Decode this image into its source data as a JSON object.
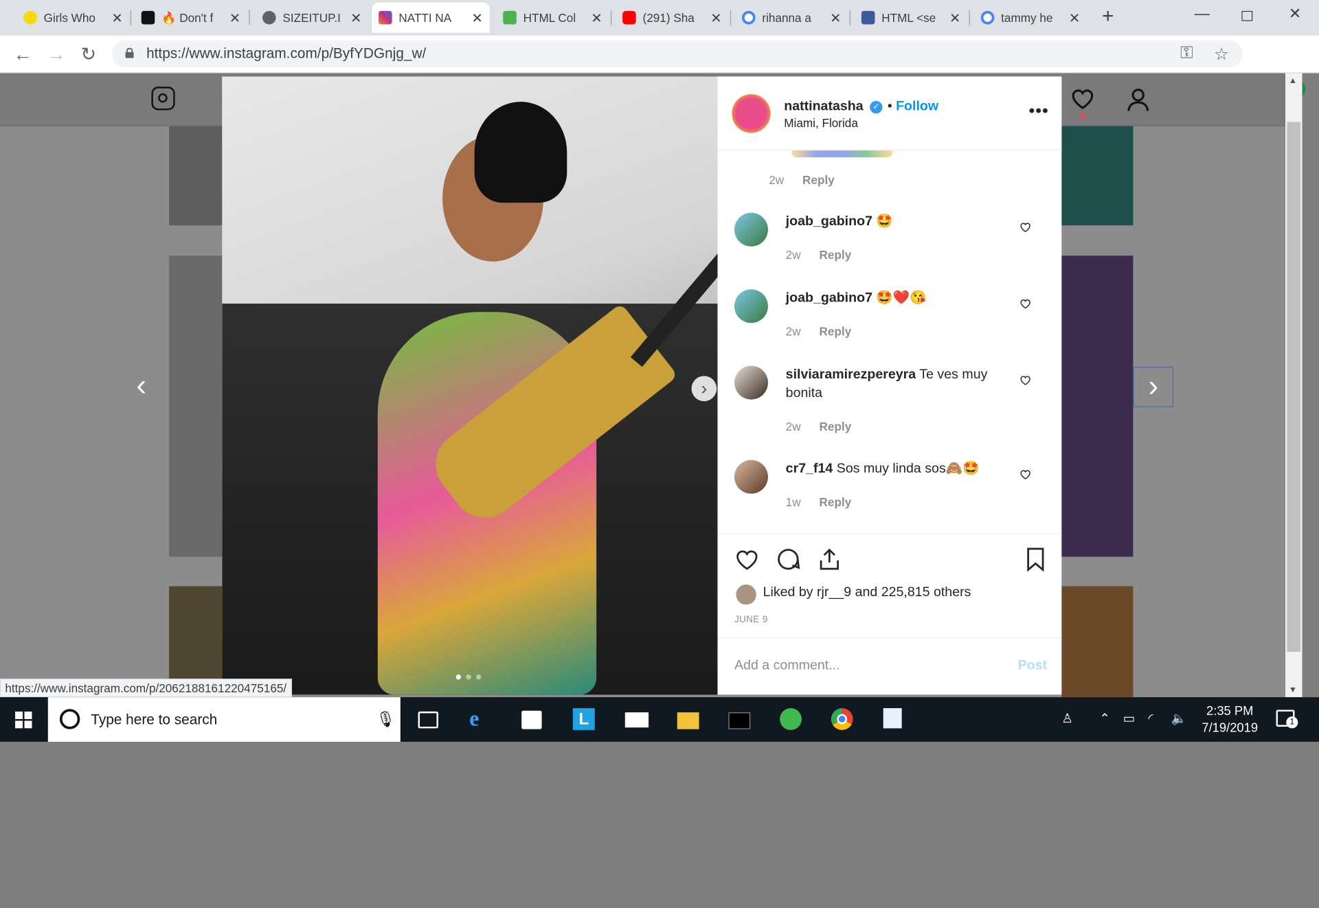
{
  "browser": {
    "tabs": [
      {
        "title": "Girls Who",
        "icon_color": "#f5d90a"
      },
      {
        "title": "🔥 Don't f",
        "icon_color": "#111111"
      },
      {
        "title": "SIZEITUP.I",
        "icon_color": "#5f6368"
      },
      {
        "title": "NATTI NA",
        "icon_color": "#c13584"
      },
      {
        "title": "HTML Col",
        "icon_color": "#4caf50"
      },
      {
        "title": "(291) Sha",
        "icon_color": "#ff0000"
      },
      {
        "title": "rihanna a",
        "icon_color": "#4285f4"
      },
      {
        "title": "HTML <se",
        "icon_color": "#3c5a9a"
      },
      {
        "title": "tammy he",
        "icon_color": "#4285f4"
      }
    ],
    "active_tab": 3,
    "url": "https://www.instagram.com/p/ByfYDGnjg_w/",
    "status_url": "https://www.instagram.com/p/2062188161220475165/"
  },
  "post": {
    "username": "nattinatasha",
    "follow_label": "Follow",
    "location": "Miami, Florida",
    "more_label": "•••",
    "comments": [
      {
        "user": "joab_gabino7",
        "text": "🤩",
        "time": "2w",
        "reply": "Reply"
      },
      {
        "user": "joab_gabino7",
        "text": "🤩❤️😘",
        "time": "2w",
        "reply": "Reply"
      },
      {
        "user": "silviaramirezpereyra",
        "text": "Te ves muy bonita",
        "time": "2w",
        "reply": "Reply"
      },
      {
        "user": "cr7_f14",
        "text": "Sos muy linda sos🙈🤩",
        "time": "1w",
        "reply": "Reply"
      }
    ],
    "partial_comment": {
      "time": "2w",
      "reply": "Reply"
    },
    "likes_text": "Liked by rjr__9 and 225,815 others",
    "date": "JUNE 9",
    "add_comment_placeholder": "Add a comment...",
    "post_button": "Post"
  },
  "taskbar": {
    "search_placeholder": "Type here to search",
    "time": "2:35 PM",
    "date": "7/19/2019",
    "notification_count": "1"
  }
}
